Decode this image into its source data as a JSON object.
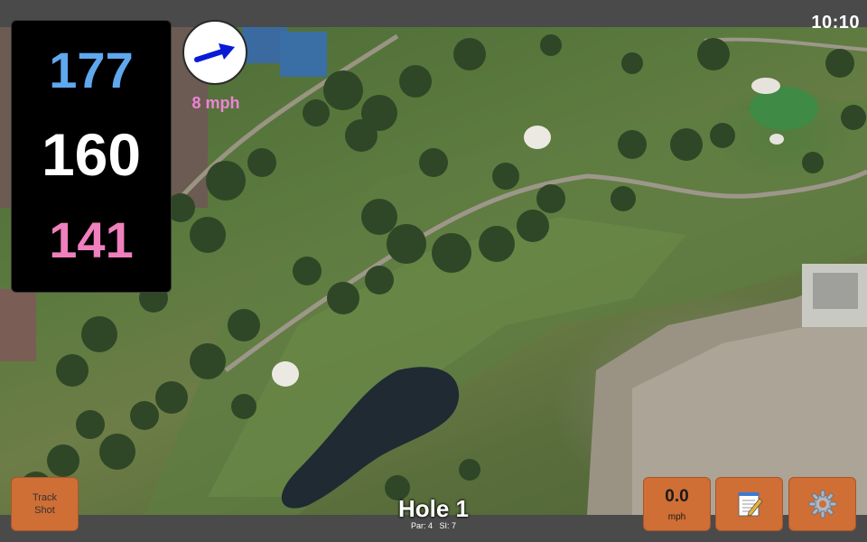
{
  "status_bar": {
    "time": "10:10"
  },
  "yardages": {
    "back": "177",
    "middle": "160",
    "front": "141"
  },
  "wind": {
    "speed_label": "8 mph",
    "arrow_icon": "wind-direction-arrow-icon"
  },
  "hole": {
    "title": "Hole 1",
    "par_label": "Par: 4",
    "si_label": "SI: 7"
  },
  "buttons": {
    "track_shot_line1": "Track",
    "track_shot_line2": "Shot",
    "wind_value": "0.0",
    "wind_unit": "mph",
    "notes_icon": "notepad-icon",
    "settings_icon": "gear-icon"
  },
  "colors": {
    "back_yardage": "#5fa8ee",
    "middle_yardage": "#ffffff",
    "front_yardage": "#f07fbd",
    "wind_speed": "#ee83d6",
    "button_bg": "#cf6e35"
  }
}
